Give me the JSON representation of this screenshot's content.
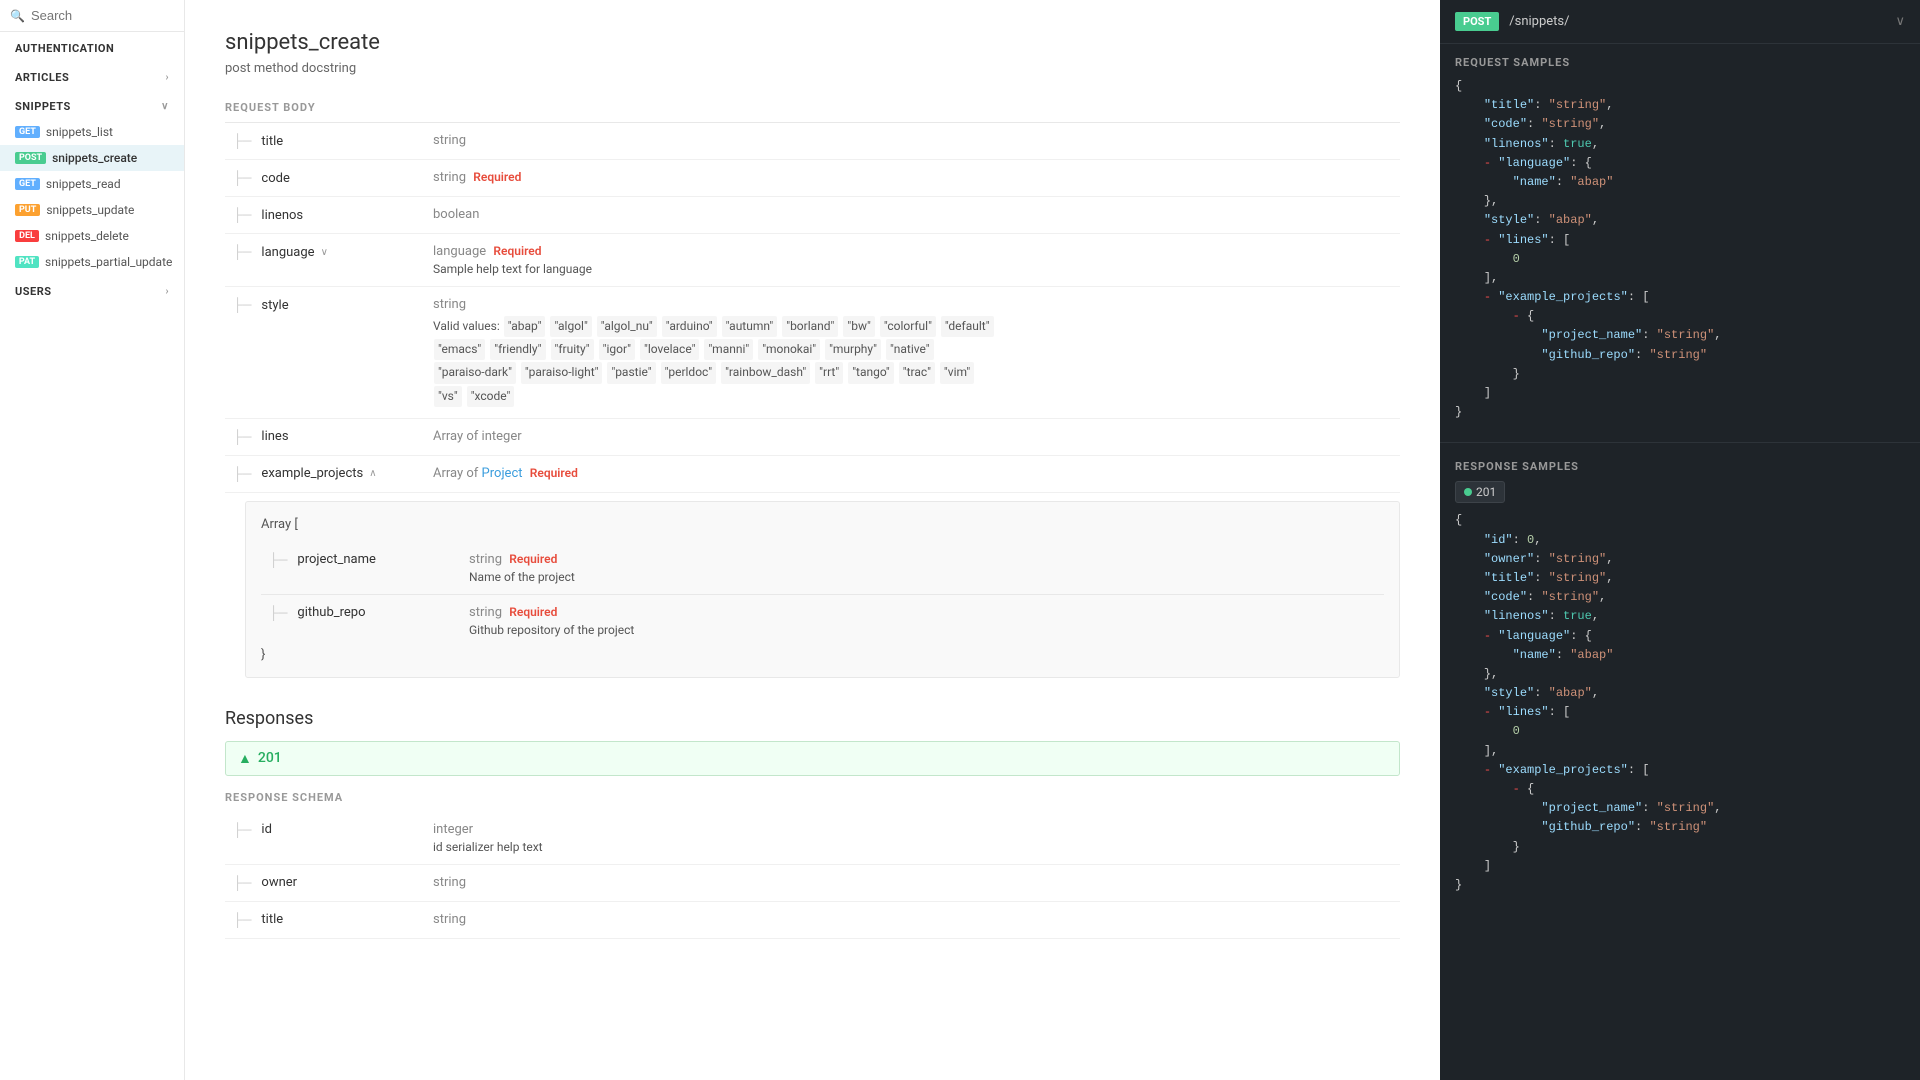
{
  "sidebar": {
    "search_placeholder": "Search",
    "groups": [
      {
        "id": "authentication",
        "label": "AUTHENTICATION",
        "has_chevron": false,
        "items": []
      },
      {
        "id": "articles",
        "label": "ARTICLES",
        "has_chevron": true,
        "items": []
      },
      {
        "id": "snippets",
        "label": "SNIPPETS",
        "has_chevron": true,
        "items": [
          {
            "id": "snippets_list",
            "label": "snippets_list",
            "method": "GET",
            "badge": "GET",
            "active": false
          },
          {
            "id": "snippets_create",
            "label": "snippets_create",
            "method": "POST",
            "badge": "POST",
            "active": true
          },
          {
            "id": "snippets_read",
            "label": "snippets_read",
            "method": "GET",
            "badge": "GET",
            "active": false
          },
          {
            "id": "snippets_update",
            "label": "snippets_update",
            "method": "PUT",
            "badge": "PUT",
            "active": false
          },
          {
            "id": "snippets_delete",
            "label": "snippets_delete",
            "method": "DELETE",
            "badge": "DEL",
            "active": false
          },
          {
            "id": "snippets_partial_update",
            "label": "snippets_partial_update",
            "method": "PATCH",
            "badge": "PAT",
            "active": false
          }
        ]
      },
      {
        "id": "users",
        "label": "USERS",
        "has_chevron": true,
        "items": []
      }
    ]
  },
  "main": {
    "title": "snippets_create",
    "subtitle": "post method docstring",
    "request_body_label": "REQUEST BODY",
    "fields": [
      {
        "name": "title",
        "type": "string",
        "required": false,
        "description": ""
      },
      {
        "name": "code",
        "type": "string",
        "required": true,
        "description": ""
      },
      {
        "name": "linenos",
        "type": "boolean",
        "required": false,
        "description": ""
      },
      {
        "name": "language",
        "type": "language",
        "required": true,
        "description": "Sample help text for language",
        "expandable": true,
        "expanded": true
      },
      {
        "name": "style",
        "type": "string",
        "required": false,
        "description": "Valid values:",
        "has_values": true,
        "values": [
          "abap",
          "algol",
          "algol_nu",
          "arduino",
          "autumn",
          "borland",
          "bw",
          "colorful",
          "default",
          "emacs",
          "friendly",
          "fruity",
          "igor",
          "lovelace",
          "manni",
          "monokai",
          "murphy",
          "native",
          "paraiso-dark",
          "paraiso-light",
          "pastie",
          "perldoc",
          "rainbow_dash",
          "rrt",
          "tango",
          "trac",
          "vim",
          "vs",
          "xcode"
        ]
      },
      {
        "name": "lines",
        "type": "Array of integer",
        "required": false,
        "description": ""
      },
      {
        "name": "example_projects",
        "type": "Array of Project",
        "required": true,
        "description": "",
        "expandable": true,
        "expanded": true
      }
    ],
    "nested_block": {
      "header": "Array [",
      "footer": "}",
      "fields": [
        {
          "name": "project_name",
          "type": "string",
          "required": true,
          "description": "Name of the project"
        },
        {
          "name": "github_repo",
          "type": "string",
          "required": true,
          "description": "Github repository of the project"
        }
      ]
    },
    "responses_label": "Responses",
    "response_code": "201",
    "response_schema_label": "RESPONSE SCHEMA",
    "response_fields": [
      {
        "name": "id",
        "type": "integer",
        "required": false,
        "description": "id serializer help text"
      },
      {
        "name": "owner",
        "type": "string",
        "required": false,
        "description": ""
      },
      {
        "name": "title",
        "type": "string",
        "required": false,
        "description": ""
      }
    ]
  },
  "right_panel": {
    "method": "POST",
    "path": "/snippets/",
    "request_samples_label": "REQUEST SAMPLES",
    "response_samples_label": "RESPONSE SAMPLES",
    "response_tab_label": "201",
    "request_sample_code": "{\n    \"title\": \"string\",\n    \"code\": \"string\",\n    \"linenos\": true,\n    - \"language\": {\n        \"name\": \"abap\"\n    },\n    \"style\": \"abap\",\n    - \"lines\": [\n        0\n    ],\n    - \"example_projects\": [\n        - {\n            \"project_name\": \"string\",\n            \"github_repo\": \"string\"\n        }\n    ]\n}",
    "response_sample_code": "{\n    \"id\": 0,\n    \"owner\": \"string\",\n    \"title\": \"string\",\n    \"code\": \"string\",\n    \"linenos\": true,\n    - \"language\": {\n        \"name\": \"abap\"\n    },\n    \"style\": \"abap\",\n    - \"lines\": [\n        0\n    ],\n    - \"example_projects\": [\n        - {\n            \"project_name\": \"string\",\n            \"github_repo\": \"string\"\n        }\n    ]\n}"
  }
}
